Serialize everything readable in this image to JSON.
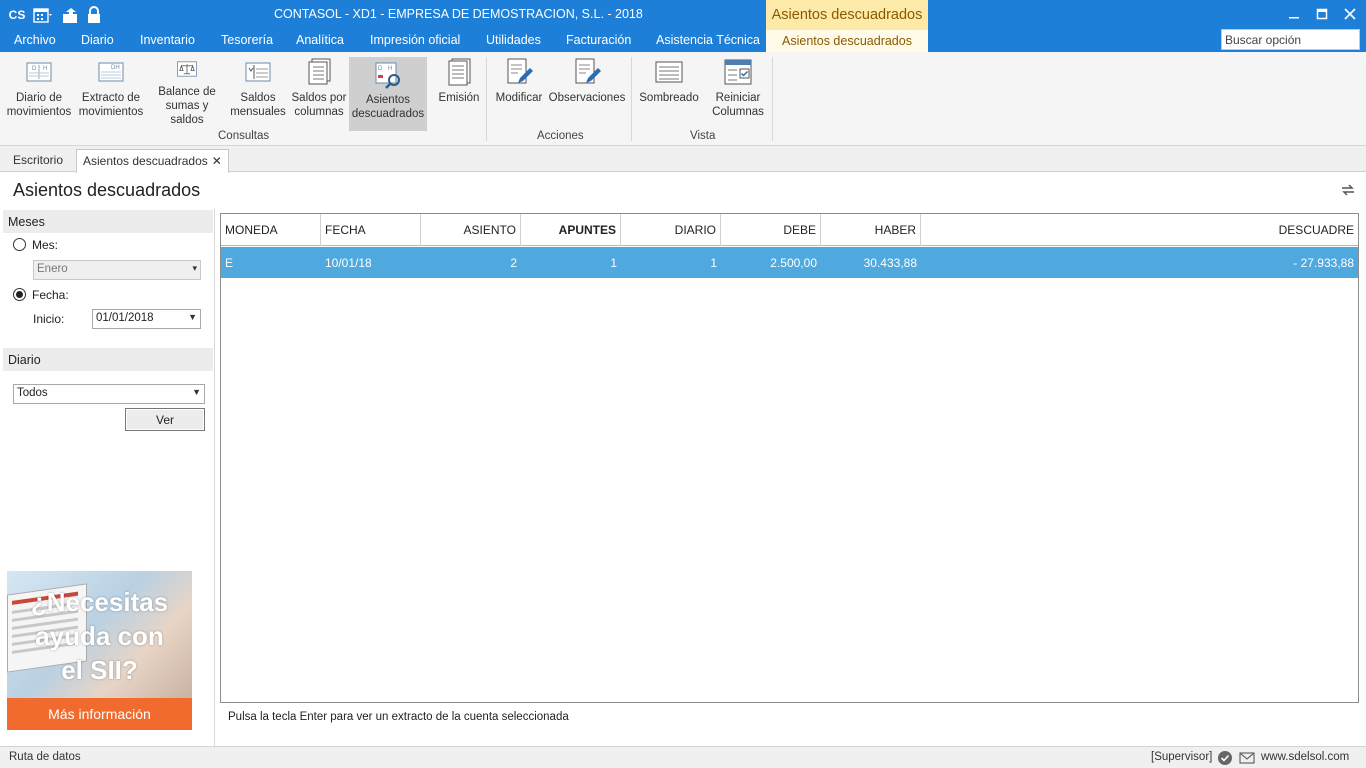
{
  "titlebar": {
    "app_title": "CONTASOL - XD1 - EMPRESA DE DEMOSTRACION, S.L. - 2018",
    "context_title": "Asientos descuadrados",
    "quick_access_logo": "CS",
    "icons": [
      "cs-logo-icon",
      "calendar-icon",
      "folder-up-icon",
      "lock-icon",
      "minimize-icon",
      "maximize-icon",
      "close-icon"
    ]
  },
  "menubar": {
    "items": [
      "Archivo",
      "Diario",
      "Inventario",
      "Tesorería",
      "Analítica",
      "Impresión oficial",
      "Utilidades",
      "Facturación",
      "Asistencia Técnica"
    ],
    "context_tab": "Asientos descuadrados",
    "search_placeholder": "Buscar opción"
  },
  "ribbon": {
    "buttons": [
      {
        "line1": "Diario de",
        "line2": "movimientos",
        "icon": "ledger-dh-icon"
      },
      {
        "line1": "Extracto de",
        "line2": "movimientos",
        "icon": "extract-dh-icon"
      },
      {
        "line1": "Balance de",
        "line2": "sumas y saldos",
        "icon": "scale-icon"
      },
      {
        "line1": "Saldos",
        "line2": "mensuales",
        "icon": "monthly-balance-icon"
      },
      {
        "line1": "Saldos por",
        "line2": "columnas",
        "icon": "column-balance-icon"
      },
      {
        "line1": "Asientos",
        "line2": "descuadrados",
        "icon": "unbalanced-entries-icon"
      },
      {
        "line1": "Emisión",
        "line2": "",
        "icon": "print-document-icon"
      },
      {
        "line1": "Modificar",
        "line2": "",
        "icon": "edit-document-icon"
      },
      {
        "line1": "Observaciones",
        "line2": "",
        "icon": "notes-document-icon"
      },
      {
        "line1": "Sombreado",
        "line2": "",
        "icon": "shading-icon"
      },
      {
        "line1": "Reiniciar",
        "line2": "Columnas",
        "icon": "reset-columns-icon"
      }
    ],
    "groups": [
      "Consultas",
      "Acciones",
      "Vista"
    ]
  },
  "doctabs": {
    "tabs": [
      "Escritorio",
      "Asientos descuadrados"
    ]
  },
  "page": {
    "title": "Asientos descuadrados"
  },
  "filters": {
    "meses_header": "Meses",
    "mes_label": "Mes:",
    "mes_value": "Enero",
    "fecha_label": "Fecha:",
    "inicio_label": "Inicio:",
    "inicio_value": "01/01/2018",
    "diario_header": "Diario",
    "diario_value": "Todos",
    "ver_button": "Ver"
  },
  "ad": {
    "line1": "¿Necesitas",
    "line2": "ayuda con",
    "line3": "el SII?",
    "button": "Más información"
  },
  "grid": {
    "columns": [
      "MONEDA",
      "FECHA",
      "ASIENTO",
      "APUNTES",
      "DIARIO",
      "DEBE",
      "HABER",
      "DESCUADRE"
    ],
    "rows": [
      {
        "moneda": "E",
        "fecha": "10/01/18",
        "asiento": "2",
        "apuntes": "1",
        "diario": "1",
        "debe": "2.500,00",
        "haber": "30.433,88",
        "descuadre": "- 27.933,88"
      }
    ],
    "selected_row_color": "#4fa8de"
  },
  "hint": "Pulsa la tecla Enter para ver un extracto de la cuenta seleccionada",
  "statusbar": {
    "left": "Ruta de datos",
    "user": "[Supervisor]",
    "url": "www.sdelsol.com"
  },
  "colors": {
    "accent": "#1e7fd8",
    "context_tab": "#fdeaa8",
    "ad_button": "#f26b2e"
  }
}
